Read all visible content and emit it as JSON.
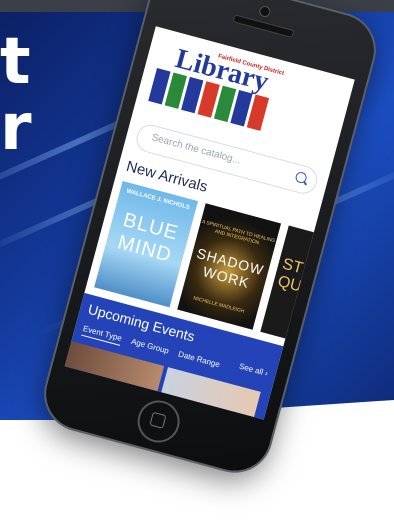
{
  "hero": {
    "letters": [
      "t",
      "r"
    ]
  },
  "app": {
    "logo": {
      "word": "Library",
      "subtitle": "Fairfield County District"
    },
    "search": {
      "placeholder": "Search the catalog..."
    },
    "new_arrivals": {
      "title": "New Arrivals",
      "books": [
        {
          "author": "WALLACE J. NICHOLS",
          "title": "BLUE MIND"
        },
        {
          "subtitle": "A SPIRITUAL PATH TO HEALING AND INTEGRATION",
          "title": "SHADOW WORK",
          "author": "MICHELLE MADLEIGH"
        },
        {
          "title": "ST QU"
        }
      ]
    },
    "events": {
      "title": "Upcoming Events",
      "see_all": "See all",
      "filters": [
        "Event Type",
        "Age Group",
        "Date Range"
      ]
    }
  },
  "colors": {
    "brand_blue": "#2443b8",
    "background_blue": "#143a9c"
  },
  "icons": [
    "search-icon",
    "chevron-right-icon",
    "home-button-icon"
  ]
}
